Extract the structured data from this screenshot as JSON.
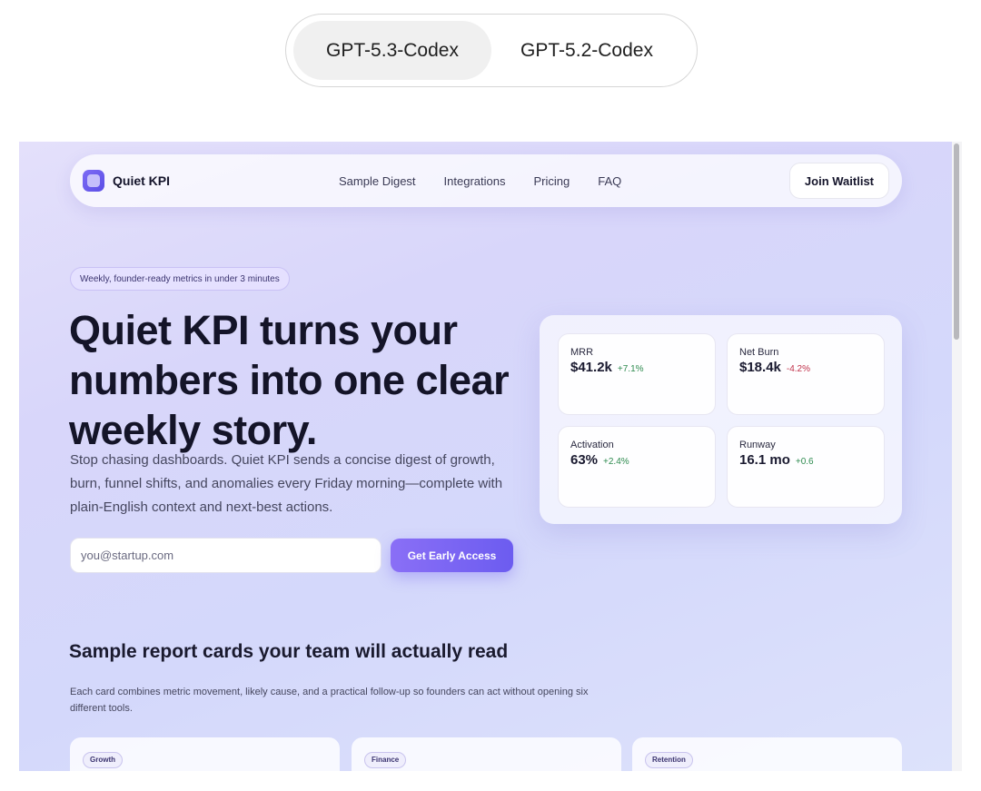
{
  "model_toggle": {
    "options": [
      {
        "label": "GPT-5.3-Codex",
        "selected": true
      },
      {
        "label": "GPT-5.2-Codex",
        "selected": false
      }
    ]
  },
  "nav": {
    "brand": "Quiet KPI",
    "links": [
      "Sample Digest",
      "Integrations",
      "Pricing",
      "FAQ"
    ],
    "cta": "Join Waitlist"
  },
  "hero": {
    "pill": "Weekly, founder-ready metrics in under 3 minutes",
    "title": "Quiet KPI turns your numbers into one clear weekly story.",
    "subtitle": "Stop chasing dashboards. Quiet KPI sends a concise digest of growth, burn, funnel shifts, and anomalies every Friday morning—complete with plain-English context and next-best actions.",
    "email_placeholder": "you@startup.com",
    "cta": "Get Early Access"
  },
  "metrics": [
    {
      "label": "MRR",
      "value": "$41.2k",
      "delta": "+7.1%",
      "trend": "positive"
    },
    {
      "label": "Net Burn",
      "value": "$18.4k",
      "delta": "-4.2%",
      "trend": "negative"
    },
    {
      "label": "Activation",
      "value": "63%",
      "delta": "+2.4%",
      "trend": "positive"
    },
    {
      "label": "Runway",
      "value": "16.1 mo",
      "delta": "+0.6",
      "trend": "positive"
    }
  ],
  "samples": {
    "title": "Sample report cards your team will actually read",
    "subtitle": "Each card combines metric movement, likely cause, and a practical follow-up so founders can act without opening six different tools.",
    "cards": [
      {
        "tag": "Growth"
      },
      {
        "tag": "Finance"
      },
      {
        "tag": "Retention"
      }
    ]
  },
  "colors": {
    "accent": "#6c5cf0",
    "positive": "#2e8b4f",
    "negative": "#c0314a"
  }
}
